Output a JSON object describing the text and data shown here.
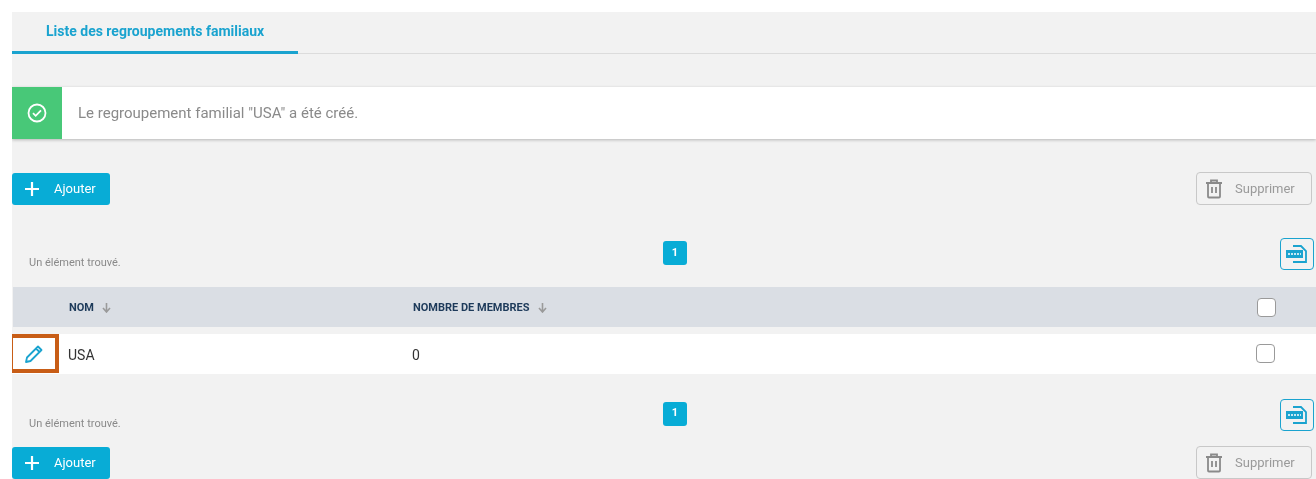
{
  "tabs": [
    {
      "label": "Liste des regroupements familiaux",
      "selected": true
    }
  ],
  "alert": {
    "kind": "success",
    "message": "Le regroupement familial \"USA\" a été créé."
  },
  "toolbar_top": {
    "add_button": "Ajouter",
    "delete_button": {
      "label": "Supprimer",
      "disabled": true
    }
  },
  "pagination_top": {
    "count_text": "Un élément trouvé.",
    "pages": [
      {
        "label": "1",
        "selected": true
      }
    ]
  },
  "table": {
    "columns": [
      {
        "label": "NOM",
        "sortable": true
      },
      {
        "label": "NOMBRE DE MEMBRES",
        "sortable": true
      }
    ],
    "select_all_checked": false,
    "rows": [
      {
        "cells": [
          "USA",
          "0"
        ],
        "checked": false,
        "edit_highlighted": true
      }
    ]
  },
  "pagination_bottom": {
    "count_text": "Un élément trouvé.",
    "pages": [
      {
        "label": "1",
        "selected": true
      }
    ]
  },
  "toolbar_bottom": {
    "add_button": "Ajouter",
    "delete_button": {
      "label": "Supprimer",
      "disabled": true
    }
  }
}
